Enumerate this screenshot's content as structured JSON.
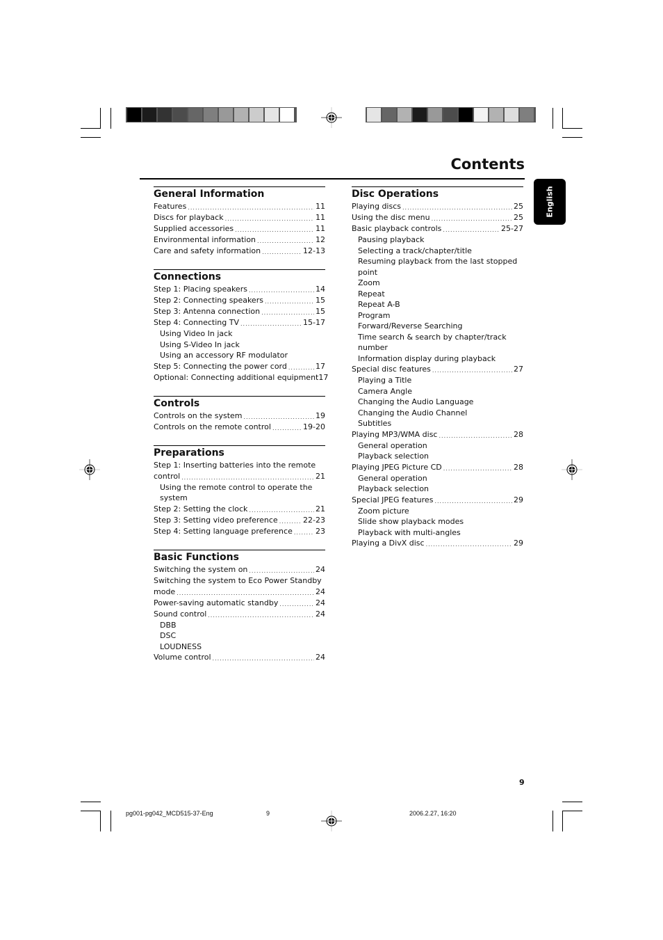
{
  "page": {
    "title": "Contents",
    "language_tab": "English",
    "page_number": "9"
  },
  "color_bars": {
    "left": [
      "#000000",
      "#1b1b1b",
      "#333333",
      "#4c4c4c",
      "#666666",
      "#7f7f7f",
      "#999999",
      "#b2b2b2",
      "#cccccc",
      "#e5e5e5",
      "#ffffff"
    ],
    "right": [
      "#e5e5e5",
      "#666666",
      "#b2b2b2",
      "#1b1b1b",
      "#999999",
      "#4c4c4c",
      "#000000",
      "#f2f2f2",
      "#b2b2b2",
      "#dddddd",
      "#7f7f7f"
    ]
  },
  "left_column": [
    {
      "heading": "General Information",
      "entries": [
        {
          "label": "Features",
          "page": "11"
        },
        {
          "label": "Discs for playback",
          "page": "11"
        },
        {
          "label": "Supplied accessories",
          "page": "11"
        },
        {
          "label": "Environmental information",
          "page": "12"
        },
        {
          "label": "Care and safety information",
          "page": "12-13"
        }
      ]
    },
    {
      "heading": "Connections",
      "entries": [
        {
          "label": "Step 1: Placing speakers",
          "page": "14"
        },
        {
          "label": "Step 2: Connecting speakers",
          "page": "15"
        },
        {
          "label": "Step 3: Antenna connection",
          "page": "15"
        },
        {
          "label": "Step 4: Connecting TV",
          "page": "15-17",
          "subs": [
            "Using Video In jack",
            "Using S-Video In jack",
            "Using an accessory RF modulator"
          ]
        },
        {
          "label": "Step 5: Connecting the power cord",
          "page": "17"
        },
        {
          "label": "Optional: Connecting additional equipment",
          "page": "17",
          "nodots": true
        }
      ]
    },
    {
      "heading": "Controls",
      "entries": [
        {
          "label": "Controls on the system",
          "page": "19"
        },
        {
          "label": "Controls on the remote control",
          "page": "19-20"
        }
      ]
    },
    {
      "heading": "Preparations",
      "entries": [
        {
          "label": "Step 1: Inserting batteries into the remote",
          "label2": "control",
          "page": "21",
          "subs": [
            "Using the remote control to operate the system"
          ]
        },
        {
          "label": "Step 2: Setting the clock",
          "page": "21"
        },
        {
          "label": "Step 3: Setting video preference",
          "page": "22-23"
        },
        {
          "label": "Step 4: Setting language preference",
          "page": "23"
        }
      ]
    },
    {
      "heading": "Basic Functions",
      "entries": [
        {
          "label": "Switching the system on",
          "page": "24"
        },
        {
          "label": "Switching the system to Eco Power Standby",
          "label2": "mode",
          "page": "24"
        },
        {
          "label": "Power-saving automatic standby",
          "page": "24"
        },
        {
          "label": "Sound control",
          "page": "24",
          "subs": [
            "DBB",
            "DSC",
            "LOUDNESS"
          ]
        },
        {
          "label": "Volume control",
          "page": "24"
        }
      ]
    }
  ],
  "right_column": [
    {
      "heading": "Disc Operations",
      "entries": [
        {
          "label": "Playing discs",
          "page": "25"
        },
        {
          "label": "Using the disc menu",
          "page": "25"
        },
        {
          "label": "Basic playback controls",
          "page": "25-27",
          "subs": [
            "Pausing playback",
            "Selecting a track/chapter/title",
            "Resuming playback from the last stopped point",
            "Zoom",
            "Repeat",
            "Repeat A-B",
            "Program",
            "Forward/Reverse Searching",
            "Time search & search by chapter/track number",
            "Information display during playback"
          ]
        },
        {
          "label": "Special disc features",
          "page": "27",
          "subs": [
            "Playing a Title",
            "Camera Angle",
            "Changing the Audio Language",
            "Changing the Audio Channel",
            "Subtitles"
          ]
        },
        {
          "label": "Playing MP3/WMA disc",
          "page": "28",
          "subs": [
            "General operation",
            "Playback selection"
          ]
        },
        {
          "label": "Playing JPEG Picture CD",
          "page": "28",
          "subs": [
            "General operation",
            "Playback selection"
          ]
        },
        {
          "label": "Special JPEG features",
          "page": "29",
          "subs": [
            "Zoom picture",
            "Slide show playback modes",
            "Playback with multi-angles"
          ]
        },
        {
          "label": "Playing a DivX disc",
          "page": "29"
        }
      ]
    }
  ],
  "footer": {
    "file_name": "pg001-pg042_MCD515-37-Eng",
    "page": "9",
    "timestamp": "2006.2.27, 16:20"
  }
}
